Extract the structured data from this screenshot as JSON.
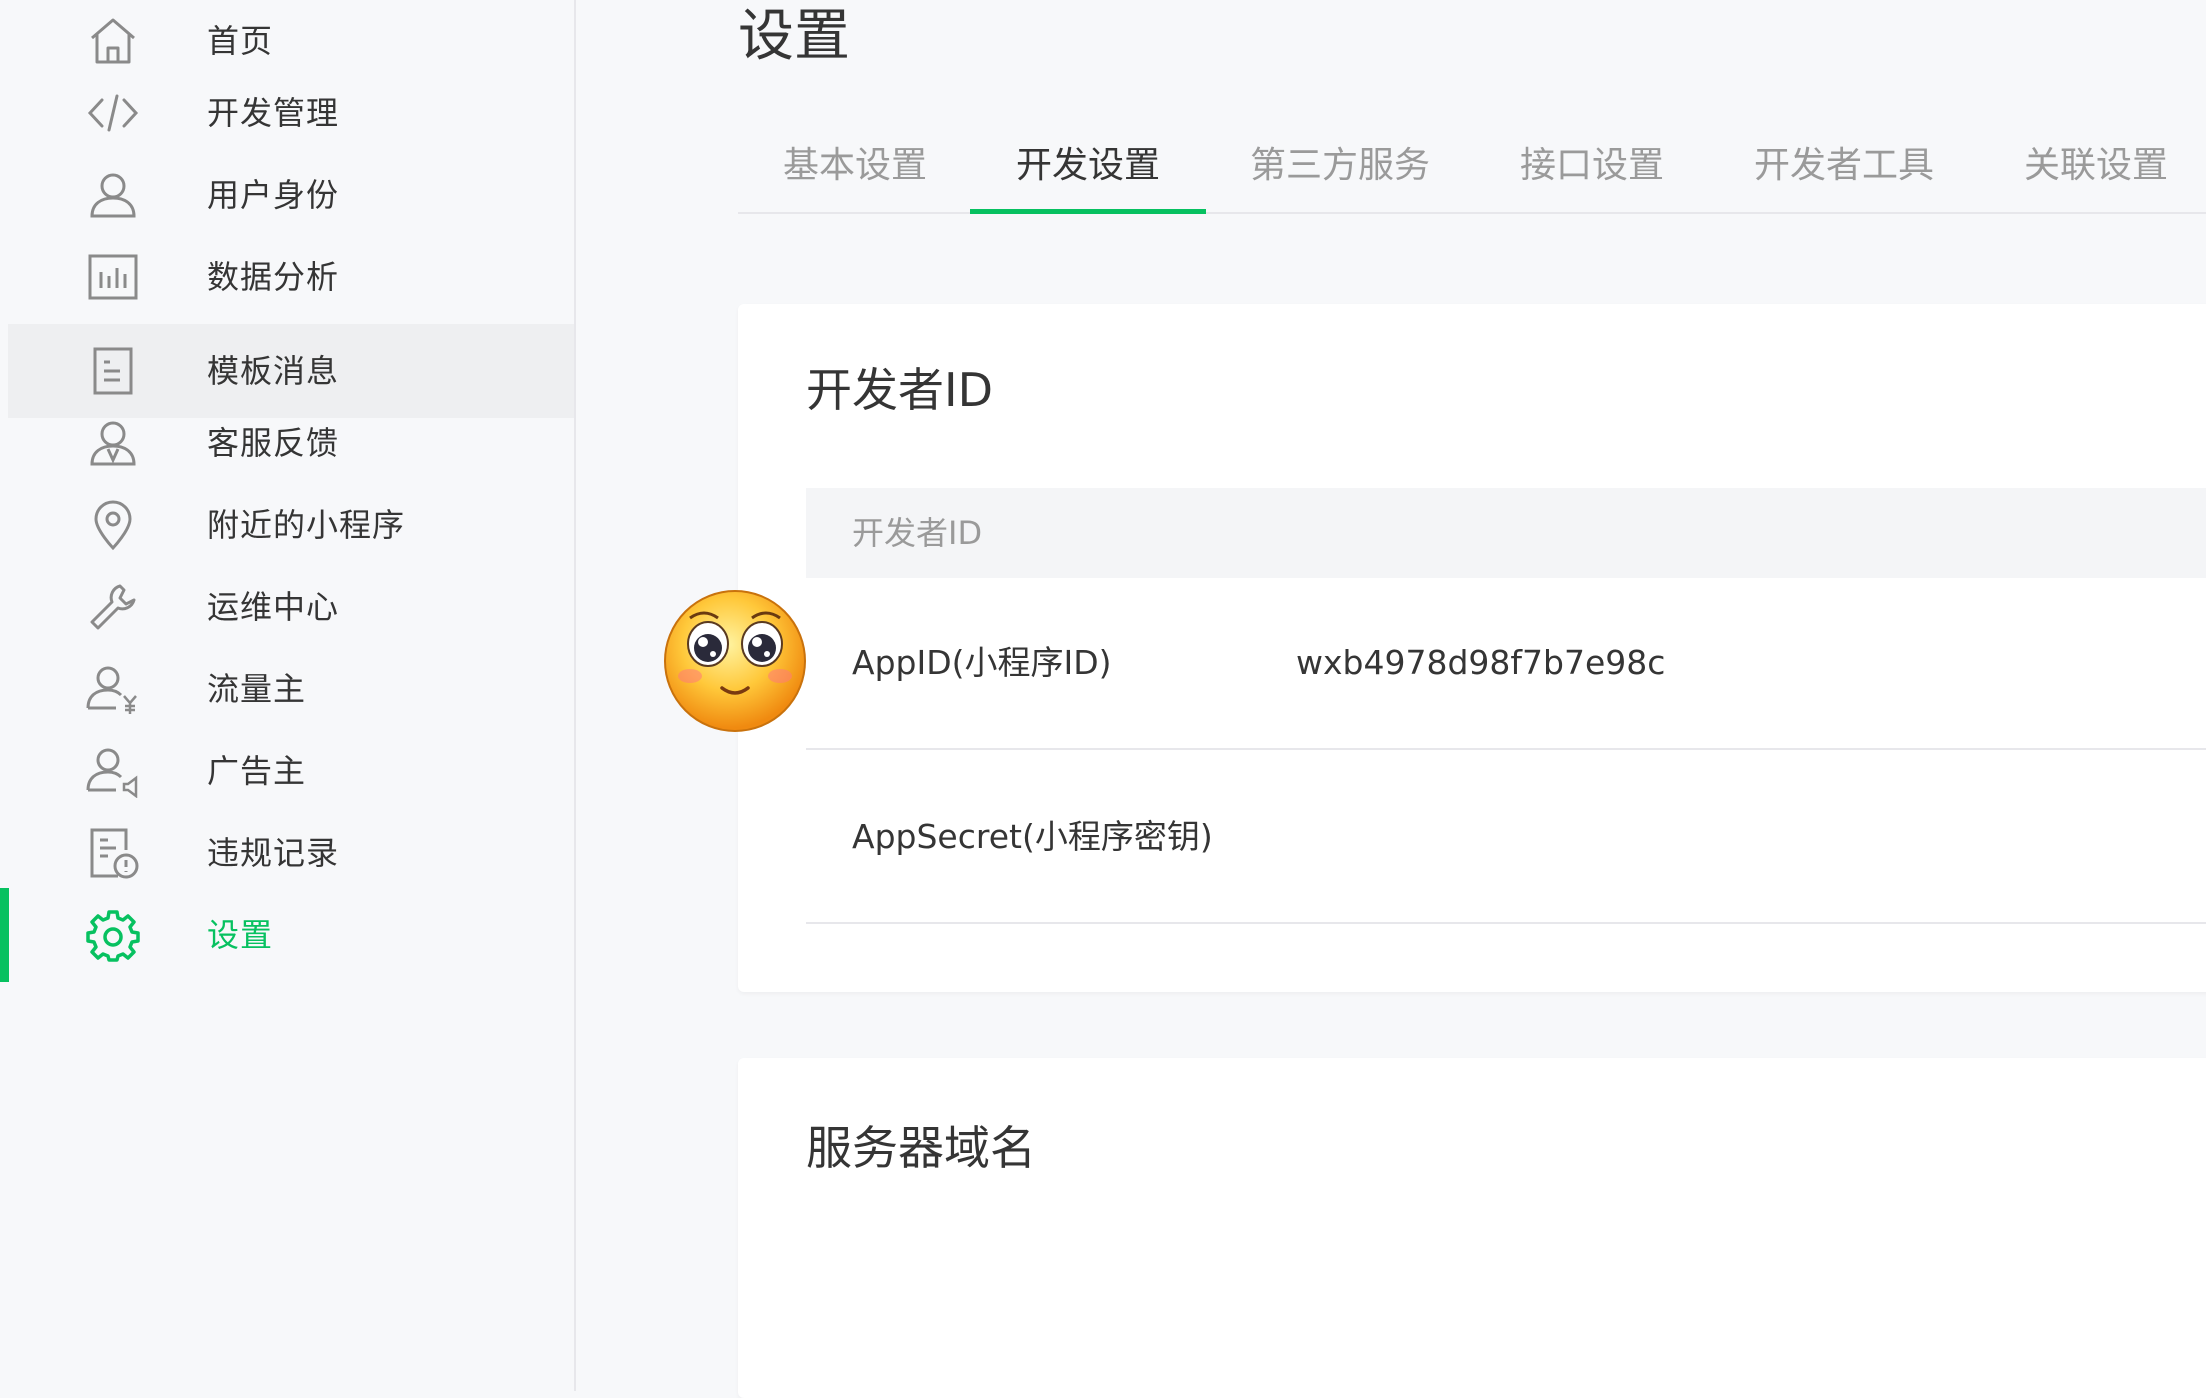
{
  "sidebar": {
    "items": [
      {
        "label": "首页",
        "icon": "home-icon"
      },
      {
        "label": "开发管理",
        "icon": "code-icon"
      },
      {
        "label": "用户身份",
        "icon": "user-icon"
      },
      {
        "label": "数据分析",
        "icon": "chart-icon"
      },
      {
        "label": "模板消息",
        "icon": "document-icon"
      },
      {
        "label": "客服反馈",
        "icon": "customer-service-icon"
      },
      {
        "label": "附近的小程序",
        "icon": "location-icon"
      },
      {
        "label": "运维中心",
        "icon": "wrench-icon"
      },
      {
        "label": "流量主",
        "icon": "user-yen-icon"
      },
      {
        "label": "广告主",
        "icon": "user-speaker-icon"
      },
      {
        "label": "违规记录",
        "icon": "violation-record-icon"
      },
      {
        "label": "设置",
        "icon": "gear-icon"
      }
    ],
    "active": "设置",
    "hovered": "模板消息"
  },
  "page": {
    "title": "设置"
  },
  "tabs": [
    "基本设置",
    "开发设置",
    "第三方服务",
    "接口设置",
    "开发者工具",
    "关联设置"
  ],
  "active_tab": "开发设置",
  "developer_id_card": {
    "title": "开发者ID",
    "table_header": "开发者ID",
    "rows": [
      {
        "label": "AppID(小程序ID)",
        "value": "wxb4978d98f7b7e98c"
      },
      {
        "label": "AppSecret(小程序密钥)",
        "value": ""
      }
    ]
  },
  "server_domain_card": {
    "title": "服务器域名"
  },
  "overlay": {
    "icon": "pleading-face-emoji-icon"
  },
  "colors": {
    "accent": "#07c160",
    "background": "#f7f8fa",
    "text": "#353535",
    "muted": "#9a9a9a"
  }
}
